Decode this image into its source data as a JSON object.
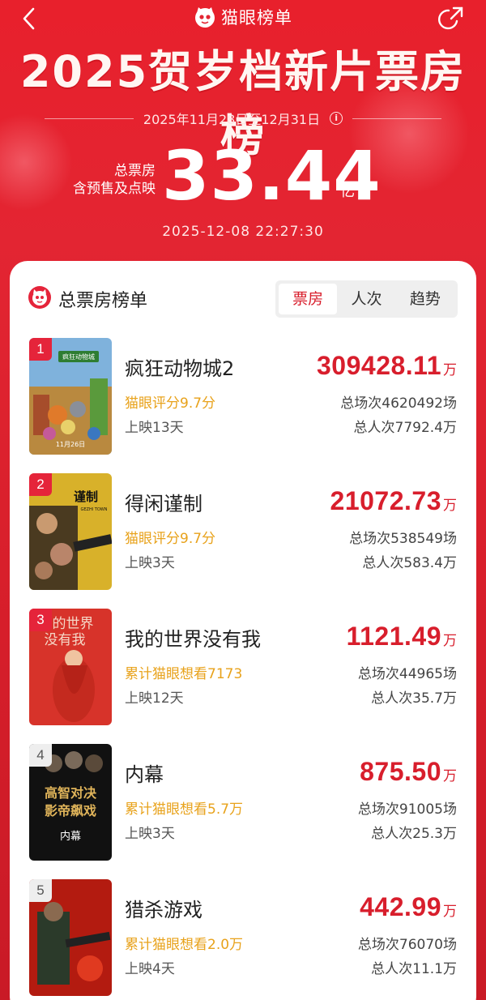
{
  "header": {
    "brand": "猫眼榜单",
    "title": "2025贺岁档新片票房榜",
    "date_range": "2025年11月28日至12月31日",
    "total_label_line1": "总票房",
    "total_label_line2": "含预售及点映",
    "total_value": "33.44",
    "total_unit": "亿",
    "timestamp": "2025-12-08   22:27:30",
    "info_icon_glyph": "i"
  },
  "card": {
    "title": "总票房榜单",
    "tabs": [
      "票房",
      "人次",
      "趋势"
    ],
    "active_tab": 0
  },
  "movies": [
    {
      "rank": "1",
      "title": "疯狂动物城2",
      "score": "猫眼评分9.7分",
      "days": "上映13天",
      "gross": "309428.11",
      "unit": "万",
      "shows": "总场次4620492场",
      "viewers": "总人次7792.4万",
      "rank_style": "red"
    },
    {
      "rank": "2",
      "title": "得闲谨制",
      "score": "猫眼评分9.7分",
      "days": "上映3天",
      "gross": "21072.73",
      "unit": "万",
      "shows": "总场次538549场",
      "viewers": "总人次583.4万",
      "rank_style": "red"
    },
    {
      "rank": "3",
      "title": "我的世界没有我",
      "score": "累计猫眼想看7173",
      "days": "上映12天",
      "gross": "1121.49",
      "unit": "万",
      "shows": "总场次44965场",
      "viewers": "总人次35.7万",
      "rank_style": "red"
    },
    {
      "rank": "4",
      "title": "内幕",
      "score": "累计猫眼想看5.7万",
      "days": "上映3天",
      "gross": "875.50",
      "unit": "万",
      "shows": "总场次91005场",
      "viewers": "总人次25.3万",
      "rank_style": "grey"
    },
    {
      "rank": "5",
      "title": "猎杀游戏",
      "score": "累计猫眼想看2.0万",
      "days": "上映4天",
      "gross": "442.99",
      "unit": "万",
      "shows": "总场次76070场",
      "viewers": "总人次11.1万",
      "rank_style": "grey"
    }
  ],
  "posters": {
    "1": {
      "text": "疯狂动物城",
      "date_text": "11月26日",
      "colors": [
        "#6fa8d8",
        "#5a9a3c",
        "#e0b45a",
        "#a64d2b"
      ]
    },
    "2": {
      "text": "得闲谨制",
      "sub_text": "GEZHI TOWN",
      "colors": [
        "#d8b12a",
        "#4a3a20",
        "#222222"
      ]
    },
    "3": {
      "text": "的世界",
      "text2": "没有我",
      "colors": [
        "#d7332a",
        "#f0c3a0",
        "#c42a1f"
      ]
    },
    "4": {
      "text": "高智对决",
      "text2": "影帝飙戏",
      "text3": "内幕",
      "colors": [
        "#111111",
        "#c9a65a",
        "#7a0d10"
      ]
    },
    "5": {
      "colors": [
        "#b31b10",
        "#2b3a2a",
        "#e03a20"
      ]
    }
  },
  "colors": {
    "accent": "#d81e2c",
    "score": "#e8a21b",
    "background": "#e32532"
  }
}
